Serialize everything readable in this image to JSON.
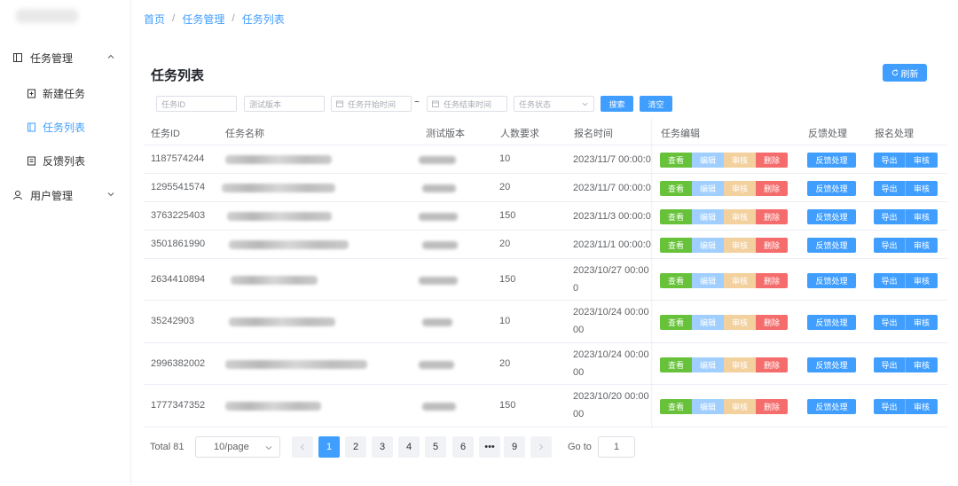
{
  "sidebar": {
    "groups": [
      {
        "label": "任务管理",
        "items": [
          {
            "label": "新建任务",
            "icon": "document-plus-icon"
          },
          {
            "label": "任务列表",
            "icon": "list-icon",
            "active": true
          },
          {
            "label": "反馈列表",
            "icon": "feedback-icon"
          }
        ]
      },
      {
        "label": "用户管理",
        "items": []
      }
    ]
  },
  "breadcrumb": [
    "首页",
    "任务管理",
    "任务列表"
  ],
  "breadcrumb_sep": "/",
  "page": {
    "title": "任务列表",
    "refresh_label": "刷新"
  },
  "filters": {
    "task_id_placeholder": "任务ID",
    "version_placeholder": "测试版本",
    "start_time_placeholder": "任务开始时间",
    "range_sep": "~",
    "end_time_placeholder": "任务结束时间",
    "status_placeholder": "任务状态",
    "search_label": "搜索",
    "clear_label": "清空"
  },
  "table": {
    "columns": [
      "任务ID",
      "任务名称",
      "测试版本",
      "人数要求",
      "报名时间",
      "任务编辑",
      "反馈处理",
      "报名处理"
    ],
    "actions": {
      "view": "查看",
      "edit": "编辑",
      "audit": "审核",
      "delete": "删除",
      "feedback": "反馈处理",
      "export": "导出",
      "approve": "审核"
    },
    "rows": [
      {
        "id": "1187574244",
        "count": "10",
        "time1": "2023/11/7 00:00:0",
        "time2": ""
      },
      {
        "id": "1295541574",
        "count": "20",
        "time1": "2023/11/7 00:00:0",
        "time2": ""
      },
      {
        "id": "3763225403",
        "count": "150",
        "time1": "2023/11/3 00:00:0",
        "time2": ""
      },
      {
        "id": "3501861990",
        "count": "20",
        "time1": "2023/11/1 00:00:0",
        "time2": ""
      },
      {
        "id": "2634410894",
        "count": "150",
        "time1": "2023/10/27 00:00",
        "time2": "0"
      },
      {
        "id": "35242903",
        "count": "10",
        "time1": "2023/10/24 00:00",
        "time2": "00"
      },
      {
        "id": "2996382002",
        "count": "20",
        "time1": "2023/10/24 00:00",
        "time2": "00"
      },
      {
        "id": "1777347352",
        "count": "150",
        "time1": "2023/10/20 00:00",
        "time2": "00"
      }
    ]
  },
  "pagination": {
    "total": "Total 81",
    "page_size": "10/page",
    "pages": [
      "1",
      "2",
      "3",
      "4",
      "5",
      "6",
      "•••",
      "9"
    ],
    "current": "1",
    "goto_label": "Go to",
    "goto_value": "1"
  },
  "colors": {
    "primary": "#409eff",
    "success": "#67c23a",
    "danger": "#f56c6c",
    "warning_light": "#f3d19e",
    "primary_light": "#a0cfff"
  }
}
